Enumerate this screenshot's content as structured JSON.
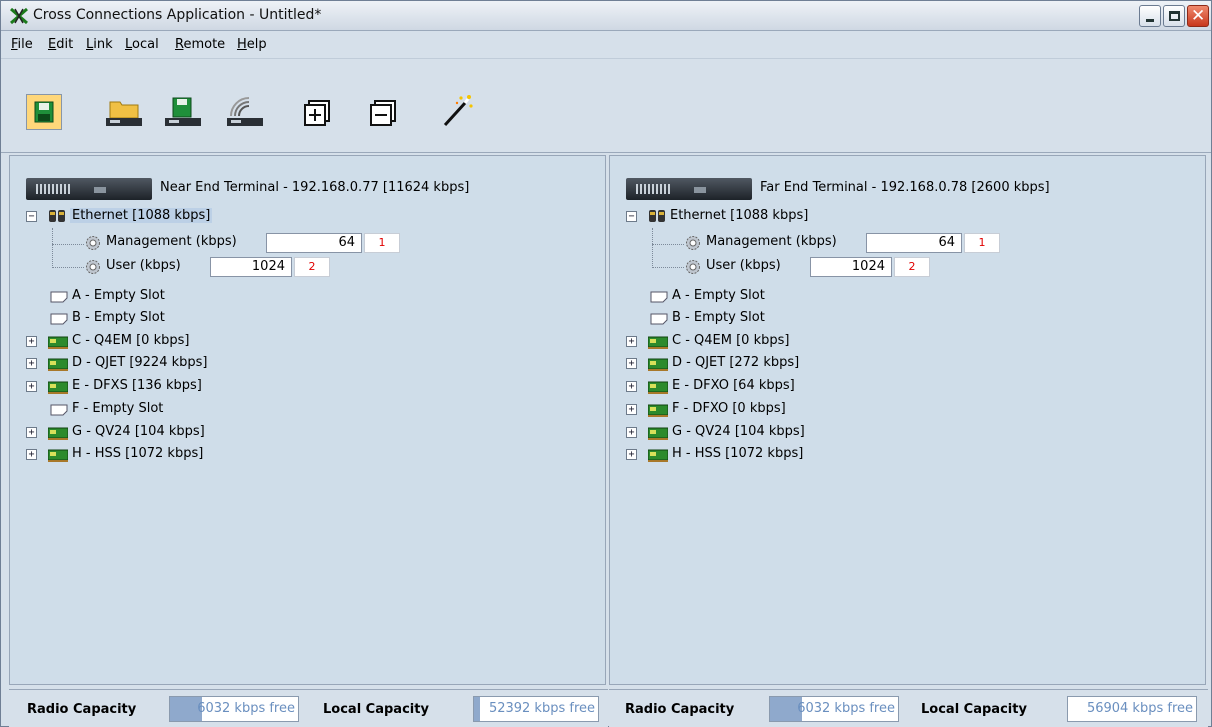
{
  "window": {
    "title": "Cross Connections Application - Untitled*",
    "accent_color": "#c8371c",
    "background_color": "#d6e0ea"
  },
  "menu": {
    "items": [
      "File",
      "Edit",
      "Link",
      "Local",
      "Remote",
      "Help"
    ]
  },
  "toolbar": {
    "buttons": [
      {
        "icon": "save-disk-icon",
        "pressed": true
      },
      {
        "icon": "open-folder-device-icon",
        "pressed": false
      },
      {
        "icon": "save-device-icon",
        "pressed": false
      },
      {
        "icon": "radio-device-icon",
        "pressed": false
      },
      {
        "icon": "expand-all-icon",
        "pressed": false
      },
      {
        "icon": "collapse-all-icon",
        "pressed": false
      },
      {
        "icon": "magic-wand-icon",
        "pressed": false
      }
    ]
  },
  "near_end": {
    "terminal_label": "Near End Terminal - 192.168.0.77 [11624 kbps]",
    "ethernet_label": "Ethernet [1088 kbps]",
    "management_label": "Management (kbps)",
    "management_value": "64",
    "management_badge": "1",
    "user_label": "User (kbps)",
    "user_value": "1024",
    "user_badge": "2",
    "slots": [
      {
        "label": "A - Empty Slot",
        "kind": "empty"
      },
      {
        "label": "B - Empty Slot",
        "kind": "empty"
      },
      {
        "label": "C - Q4EM [0 kbps]",
        "kind": "card"
      },
      {
        "label": "D - QJET [9224 kbps]",
        "kind": "card"
      },
      {
        "label": "E - DFXS [136 kbps]",
        "kind": "card"
      },
      {
        "label": "F - Empty Slot",
        "kind": "empty"
      },
      {
        "label": "G - QV24 [104 kbps]",
        "kind": "card"
      },
      {
        "label": "H - HSS [1072 kbps]",
        "kind": "card"
      }
    ],
    "radio_capacity_label": "Radio Capacity",
    "radio_capacity_text": "6032 kbps free",
    "radio_capacity_fill_fraction": 0.25,
    "local_capacity_label": "Local Capacity",
    "local_capacity_text": "52392 kbps free",
    "local_capacity_fill_fraction": 0.05
  },
  "far_end": {
    "terminal_label": "Far End Terminal - 192.168.0.78 [2600 kbps]",
    "ethernet_label": "Ethernet [1088 kbps]",
    "management_label": "Management (kbps)",
    "management_value": "64",
    "management_badge": "1",
    "user_label": "User (kbps)",
    "user_value": "1024",
    "user_badge": "2",
    "slots": [
      {
        "label": "A - Empty Slot",
        "kind": "empty"
      },
      {
        "label": "B - Empty Slot",
        "kind": "empty"
      },
      {
        "label": "C - Q4EM [0 kbps]",
        "kind": "card"
      },
      {
        "label": "D - QJET [272 kbps]",
        "kind": "card"
      },
      {
        "label": "E - DFXO [64 kbps]",
        "kind": "card"
      },
      {
        "label": "F - DFXO [0 kbps]",
        "kind": "card"
      },
      {
        "label": "G - QV24 [104 kbps]",
        "kind": "card"
      },
      {
        "label": "H - HSS [1072 kbps]",
        "kind": "card"
      }
    ],
    "radio_capacity_label": "Radio Capacity",
    "radio_capacity_text": "6032 kbps free",
    "radio_capacity_fill_fraction": 0.25,
    "local_capacity_label": "Local Capacity",
    "local_capacity_text": "56904 kbps free",
    "local_capacity_fill_fraction": 0.0
  }
}
